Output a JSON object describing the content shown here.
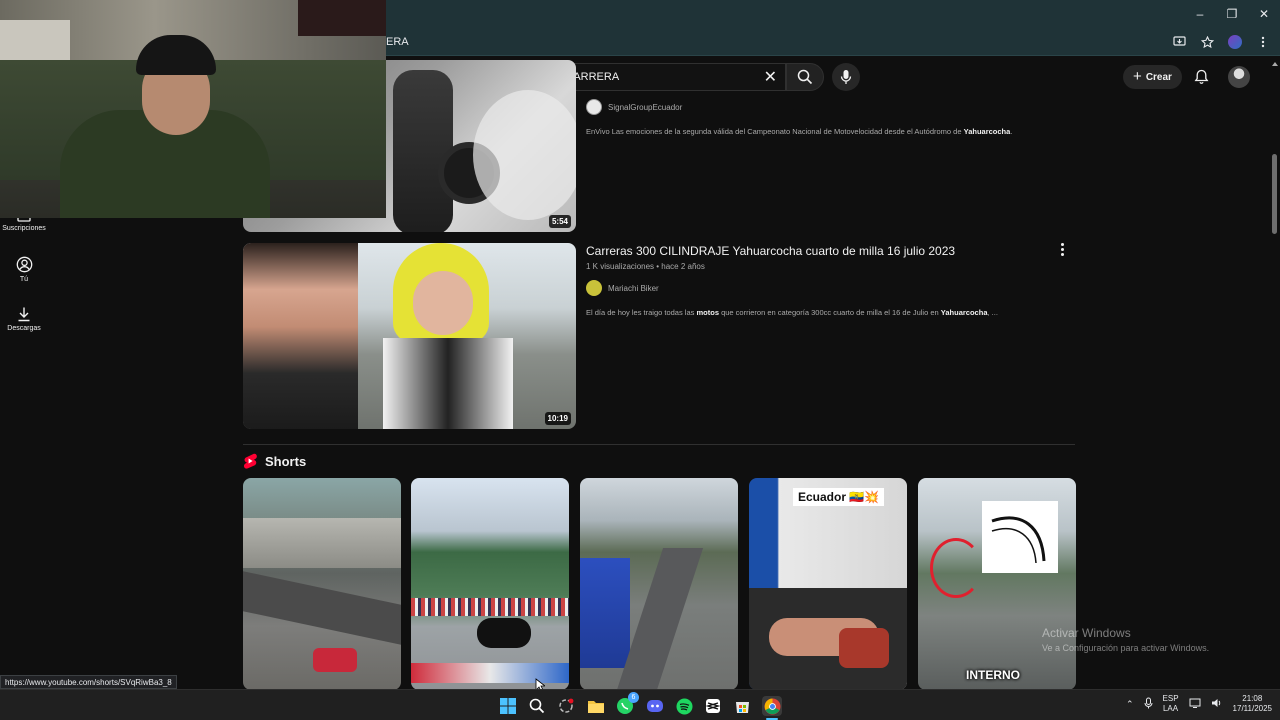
{
  "browser": {
    "url_fragment": "ERA",
    "window_controls": {
      "minimize": "–",
      "maximize": "❐",
      "close": "✕"
    }
  },
  "search": {
    "query": "YAHUARCOCHA MOTOS CARRERA"
  },
  "masthead": {
    "create_label": "Crear"
  },
  "sidebar": {
    "items": [
      {
        "label": "Suscripciones",
        "icon": "subscriptions-icon"
      },
      {
        "label": "Tú",
        "icon": "user-icon"
      },
      {
        "label": "Descargas",
        "icon": "download-icon"
      }
    ]
  },
  "videos": [
    {
      "duration": "5:54",
      "channel": "SignalGroupEcuador",
      "description_pre": "EnVivo Las emociones de la segunda válida del Campeonato Nacional de Motovelocidad desde el Autódromo de ",
      "description_bold": "Yahuarcocha",
      "description_post": "."
    },
    {
      "title": "Carreras 300 CILINDRAJE Yahuarcocha cuarto de milla 16 julio 2023",
      "meta": "1 K visualizaciones • hace 2 años",
      "duration": "10:19",
      "channel": "Mariachi Biker",
      "description_a": "El día de hoy les traigo todas las ",
      "description_b": "motos",
      "description_c": " que corrieron en categoría 300cc cuarto de milla el 16 de Julio en ",
      "description_d": "Yahuarcocha",
      "description_e": ", ..."
    }
  ],
  "shorts": {
    "title": "Shorts",
    "items": [
      {
        "overlay": ""
      },
      {
        "overlay": ""
      },
      {
        "overlay": ""
      },
      {
        "overlay": "Ecuador 🇪🇨💥"
      },
      {
        "overlay": "INTERNO"
      }
    ]
  },
  "status_bar": {
    "url": "https://www.youtube.com/shorts/SVqRiwBa3_8"
  },
  "activate_windows": {
    "title": "Activar Windows",
    "subtitle": "Ve a Configuración para activar Windows."
  },
  "taskbar": {
    "lang_top": "ESP",
    "lang_bottom": "LAA",
    "time": "21:08",
    "date": "17/11/2025",
    "notification_badge": "6"
  },
  "colors": {
    "background": "#0f0f0f",
    "browser_frame": "#1f3337",
    "taskbar": "#202020",
    "shorts_red": "#ff0033"
  }
}
